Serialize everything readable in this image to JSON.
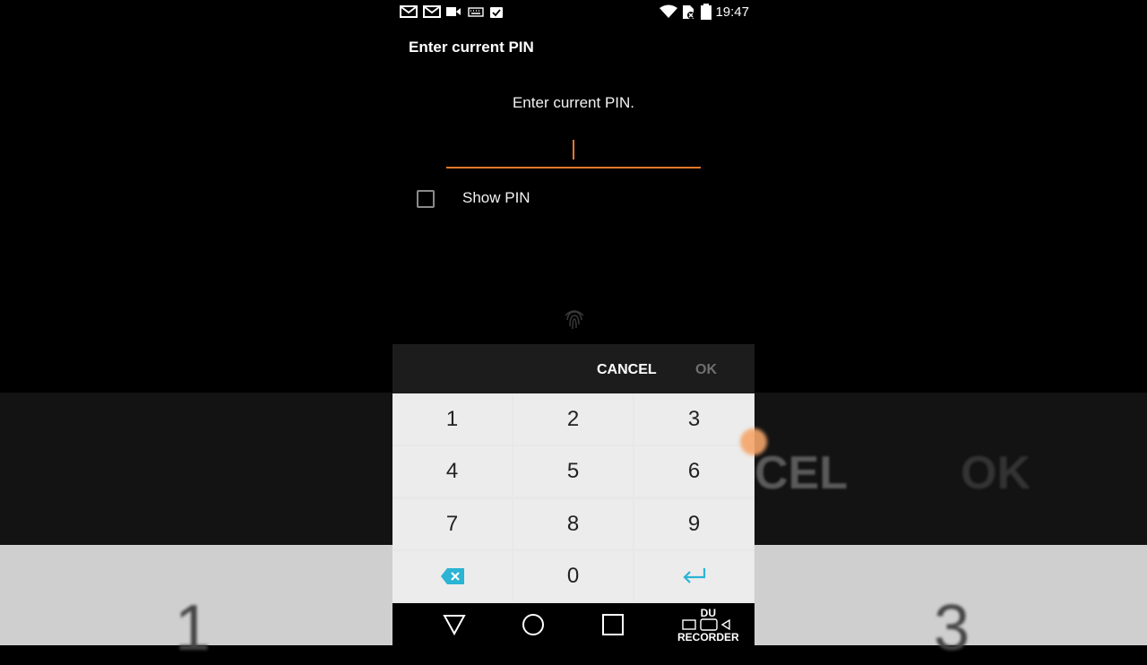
{
  "status_bar": {
    "time": "19:47",
    "left_icons": [
      "gmail-icon",
      "gmail-icon",
      "video-icon",
      "keyboard-icon",
      "clipboard-check-icon"
    ],
    "right_icons": [
      "wifi-icon",
      "sim-blocked-icon",
      "battery-icon"
    ]
  },
  "dialog": {
    "title": "Enter current PIN",
    "prompt": "Enter current PIN.",
    "pin_value": "",
    "show_pin_label": "Show PIN",
    "show_pin_checked": false,
    "accent_color": "#e8782a"
  },
  "actions": {
    "cancel_label": "CANCEL",
    "ok_label": "OK"
  },
  "keypad": {
    "keys": [
      "1",
      "2",
      "3",
      "4",
      "5",
      "6",
      "7",
      "8",
      "9",
      "0"
    ],
    "delete_icon": "backspace-icon",
    "enter_icon": "enter-icon",
    "icon_color": "#2bb4d4"
  },
  "navigation": {
    "buttons": [
      "back-icon",
      "home-icon",
      "recents-icon"
    ]
  },
  "watermark": {
    "line1": "DU",
    "line2": "RECORDER"
  },
  "background": {
    "cancel_fragment": "CEL",
    "ok_fragment": "OK",
    "one": "1",
    "three": "3"
  }
}
